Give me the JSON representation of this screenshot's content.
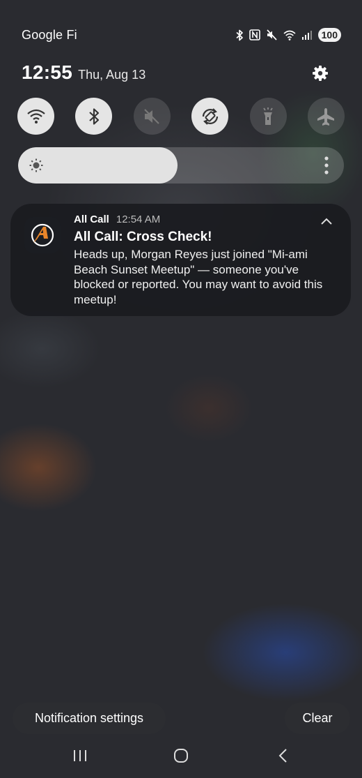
{
  "status_bar": {
    "carrier": "Google Fi",
    "battery": "100",
    "icons": [
      "bluetooth-icon",
      "nfc-icon",
      "mute-icon",
      "wifi-icon",
      "signal-icon",
      "battery-icon"
    ]
  },
  "header": {
    "time": "12:55",
    "date": "Thu, Aug 13"
  },
  "quick_settings": [
    {
      "name": "wifi",
      "active": true
    },
    {
      "name": "bluetooth",
      "active": true
    },
    {
      "name": "sound",
      "active": false
    },
    {
      "name": "auto-rotate",
      "active": true
    },
    {
      "name": "flashlight",
      "active": false
    },
    {
      "name": "airplane-mode",
      "active": false
    }
  ],
  "brightness": {
    "level": 0.49
  },
  "notification": {
    "app_name": "All Call",
    "time": "12:54 AM",
    "title": "All Call: Cross Check!",
    "body": "Heads up, Morgan Reyes just joined \"Mi-ami Beach Sunset Meetup\" — someone you've blocked or reported. You may want to avoid this meetup!",
    "accent_color": "#e8852a"
  },
  "footer": {
    "settings_label": "Notification settings",
    "clear_label": "Clear"
  },
  "nav": [
    "recents-icon",
    "home-icon",
    "back-icon"
  ]
}
